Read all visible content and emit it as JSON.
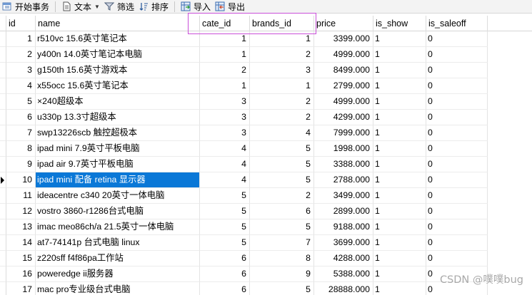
{
  "toolbar": {
    "begin_tx": "开始事务",
    "text": "文本",
    "filter": "筛选",
    "sort": "排序",
    "import": "导入",
    "export": "导出"
  },
  "columns": [
    "id",
    "name",
    "cate_id",
    "brands_id",
    "price",
    "is_show",
    "is_saleoff"
  ],
  "rows": [
    [
      "1",
      "r510vc 15.6英寸笔记本",
      "1",
      "1",
      "3399.000",
      "1",
      "0"
    ],
    [
      "2",
      "y400n 14.0英寸笔记本电脑",
      "1",
      "2",
      "4999.000",
      "1",
      "0"
    ],
    [
      "3",
      "g150th 15.6英寸游戏本",
      "2",
      "3",
      "8499.000",
      "1",
      "0"
    ],
    [
      "4",
      "x55occ 15.6英寸笔记本",
      "1",
      "1",
      "2799.000",
      "1",
      "0"
    ],
    [
      "5",
      "×240超级本",
      "3",
      "2",
      "4999.000",
      "1",
      "0"
    ],
    [
      "6",
      "u330p 13.3寸超级本",
      "3",
      "2",
      "4299.000",
      "1",
      "0"
    ],
    [
      "7",
      "swp13226scb 触控超极本",
      "3",
      "4",
      "7999.000",
      "1",
      "0"
    ],
    [
      "8",
      "ipad mini 7.9英寸平板电脑",
      "4",
      "5",
      "1998.000",
      "1",
      "0"
    ],
    [
      "9",
      "ipad air 9.7英寸平板电脑",
      "4",
      "5",
      "3388.000",
      "1",
      "0"
    ],
    [
      "10",
      "ipad mini 配备 retina 显示器",
      "4",
      "5",
      "2788.000",
      "1",
      "0"
    ],
    [
      "11",
      "ideacentre c340 20英寸一体电脑",
      "5",
      "2",
      "3499.000",
      "1",
      "0"
    ],
    [
      "12",
      "vostro 3860-r1286台式电脑",
      "5",
      "6",
      "2899.000",
      "1",
      "0"
    ],
    [
      "13",
      "imac meo86ch/a 21.5英寸一体电脑",
      "5",
      "5",
      "9188.000",
      "1",
      "0"
    ],
    [
      "14",
      "at7-74141p 台式电脑 linux",
      "5",
      "7",
      "3699.000",
      "1",
      "0"
    ],
    [
      "15",
      "z220sff f4f86pa工作站",
      "6",
      "8",
      "4288.000",
      "1",
      "0"
    ],
    [
      "16",
      "poweredge ii服务器",
      "6",
      "9",
      "5388.000",
      "1",
      "0"
    ],
    [
      "17",
      "mac pro专业级台式电脑",
      "6",
      "5",
      "28888.000",
      "1",
      "0"
    ]
  ],
  "selected_row_index": 9,
  "watermark": "CSDN @噗噗bug",
  "colors": {
    "selection": "#0a78d7",
    "highlight_box": "#c94fd9"
  }
}
